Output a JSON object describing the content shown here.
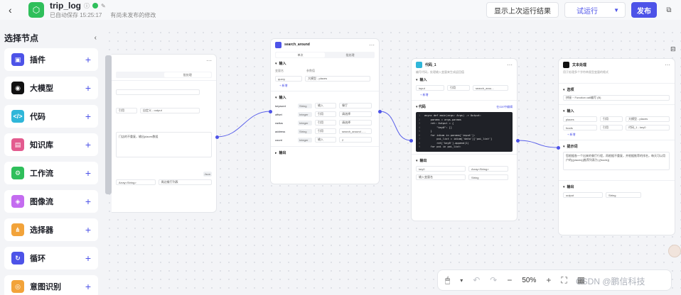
{
  "header": {
    "back_icon": "chevron-left-icon",
    "title": "trip_log",
    "autosave": "已自动保存 15:25:17",
    "unpublished": "有尚未发布的修改",
    "show_last_run": "显示上次运行结果",
    "try_run": "试运行",
    "publish": "发布"
  },
  "sidebar": {
    "title": "选择节点",
    "items": [
      {
        "label": "插件",
        "color": "#4d53e8",
        "glyph": "▣"
      },
      {
        "label": "大模型",
        "color": "#111111",
        "glyph": "◉"
      },
      {
        "label": "代码",
        "color": "#2fb6d9",
        "glyph": "</>"
      },
      {
        "label": "知识库",
        "color": "#e35b8f",
        "glyph": "▤"
      },
      {
        "label": "工作流",
        "color": "#2fbf5b",
        "glyph": "⚙"
      },
      {
        "label": "图像流",
        "color": "#c46cf0",
        "glyph": "◈"
      },
      {
        "label": "选择器",
        "color": "#f2a33a",
        "glyph": "⋔"
      },
      {
        "label": "循环",
        "color": "#4d53e8",
        "glyph": "↻"
      },
      {
        "label": "意图识别",
        "color": "#f2a33a",
        "glyph": "◎"
      }
    ]
  },
  "nodes": {
    "plugin": {
      "title": "search_around",
      "tab1": "单次",
      "tab2": "批处理",
      "section_params": "输入",
      "params_header": [
        "变量名",
        "参数值"
      ],
      "param_row": {
        "name": "query",
        "value": "大模型 - places"
      },
      "add": "+ 新增",
      "section_input": "输入",
      "inputs": [
        {
          "name": "keyword",
          "type": "String",
          "mode": "输入",
          "value": "餐厅"
        },
        {
          "name": "offset",
          "type": "Integer",
          "mode": "引用",
          "value": "请选择"
        },
        {
          "name": "radius",
          "type": "Integer",
          "mode": "引用",
          "value": "请选择"
        },
        {
          "name": "address",
          "type": "String",
          "mode": "引用",
          "value": "search_around - ..."
        },
        {
          "name": "count",
          "type": "Integer",
          "mode": "输入",
          "value": "2"
        }
      ],
      "section_output": "输出"
    },
    "code": {
      "title": "代码_1",
      "desc": "编写代码，处理输入变量来生成返回值",
      "section_input": "输入",
      "input_row": {
        "name": "input",
        "mode": "引用",
        "value": "search_arou..."
      },
      "add": "+ 新增",
      "section_code": "代码",
      "ide_link": "在IDE中编辑",
      "lines": [
        "async def main(args: Args) -> Output:",
        "    params = args.params",
        "    ret: Output = {",
        "        \"key0\": []",
        "    }",
        "    for idiom in params['input']:",
        "        poi_list = idiom['data']['poi_list']",
        "        ret['key0'].append(1)",
        "    for poi in poi_list:"
      ],
      "section_output": "输出",
      "outputs": [
        {
          "name": "key0",
          "type": "Array<String>"
        },
        {
          "name": "输入变量名",
          "type": "String"
        }
      ]
    },
    "left": {
      "tab": "批处理",
      "label": "自定义 - output",
      "mode": "引用",
      "text": "门店的不重复，输出places数组",
      "json": "Json",
      "array": "Array<String>",
      "output_desc": "周边餐厅列表"
    },
    "end": {
      "title": "文本处理",
      "desc": "用于处理多个字符串类型变量的格式",
      "section_opt": "选项",
      "option": "拼接 ~ Function call编写 (B)",
      "section_input": "输入",
      "inputs": [
        {
          "name": "places",
          "mode": "引用",
          "value": "大模型 - places"
        },
        {
          "name": "foods",
          "mode": "引用",
          "value": "代码_1 - key0"
        }
      ],
      "add": "+ 新增",
      "section_tpl": "提示词",
      "tpl": "您根据各一个出来的餐厅行程，再根据不重复，并根据推荐的排名，每天可以用户的{{places}}推荐列表为 {{foods}}",
      "section_output": "输出",
      "out_row": {
        "name": "output",
        "type": "String"
      }
    }
  },
  "toolbar": {
    "zoom": "50%"
  },
  "watermark": "CSDN @鹏信科技"
}
